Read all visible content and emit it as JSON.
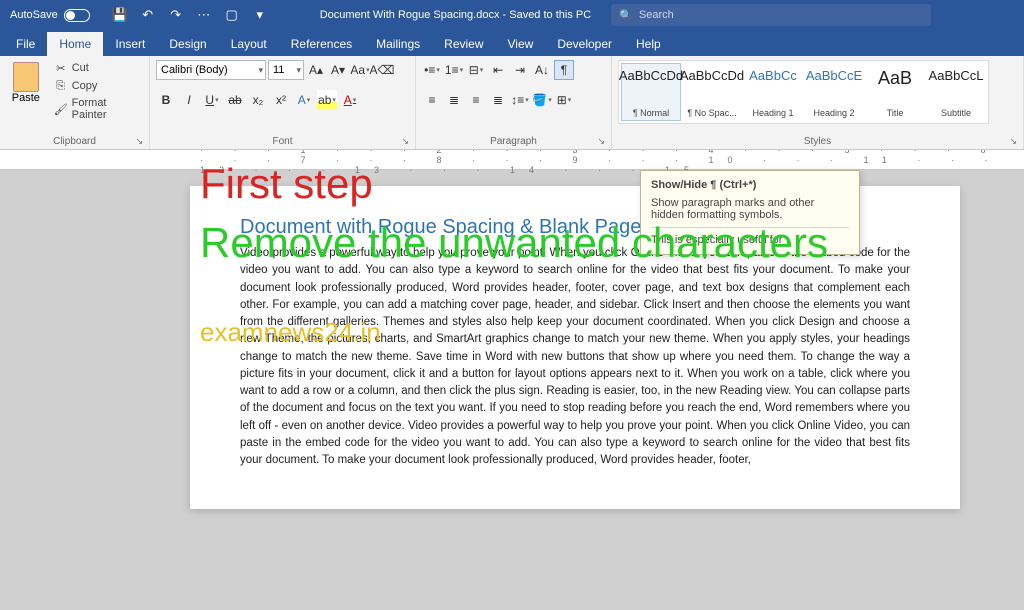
{
  "titlebar": {
    "autosave_label": "AutoSave",
    "autosave_state": "Off",
    "doc_title": "Document With Rogue Spacing.docx - Saved to this PC",
    "search_placeholder": "Search"
  },
  "tabs": [
    "File",
    "Home",
    "Insert",
    "Design",
    "Layout",
    "References",
    "Mailings",
    "Review",
    "View",
    "Developer",
    "Help"
  ],
  "active_tab": "Home",
  "clipboard": {
    "paste": "Paste",
    "cut": "Cut",
    "copy": "Copy",
    "format_painter": "Format Painter",
    "group": "Clipboard"
  },
  "font": {
    "family": "Calibri (Body)",
    "size": "11",
    "group": "Font"
  },
  "paragraph": {
    "group": "Paragraph"
  },
  "styles": {
    "group": "Styles",
    "items": [
      {
        "sample": "AaBbCcDd",
        "name": "¶ Normal",
        "cls": ""
      },
      {
        "sample": "AaBbCcDd",
        "name": "¶ No Spac...",
        "cls": ""
      },
      {
        "sample": "AaBbCc",
        "name": "Heading 1",
        "cls": "h1"
      },
      {
        "sample": "AaBbCcE",
        "name": "Heading 2",
        "cls": "h2"
      },
      {
        "sample": "AaB",
        "name": "Title",
        "cls": "title"
      },
      {
        "sample": "AaBbCcL",
        "name": "Subtitle",
        "cls": ""
      }
    ]
  },
  "tooltip": {
    "title": "Show/Hide ¶ (Ctrl+*)",
    "body1": "Show paragraph marks and other hidden formatting symbols.",
    "body2": "This is especially useful for"
  },
  "ruler": "· · · 1 · · · 2 · · · 3 · · · 4 · · · 5 · · · 6 · · · 7 · · · 8 · · · 9 · · · 10 · · · 11 · · · 12 · · · 13 · · · 14 · · · 15",
  "document": {
    "heading": "Document with Rogue Spacing & Blank Pages",
    "body": "Video provides a powerful way to help you prove your point. When you click Online Video, you can paste in the embed code for the video you want to add. You can also type a keyword to search online for the video that best fits your document. To make your document look professionally produced, Word provides header, footer, cover page, and text box designs that complement each other. For example, you can add a matching cover page, header, and sidebar. Click Insert and then choose the elements you want from the different galleries. Themes and styles also help keep your document coordinated. When you click Design and choose a new Theme, the pictures, charts, and SmartArt graphics change to match your new theme. When you apply styles, your headings change to match the new theme. Save time in Word with new buttons that show up where you need them. To change the way a picture fits in your document, click it and a button for layout options appears next to it. When you work on a table, click where you want to add a row or a column, and then click the plus sign. Reading is easier, too, in the new Reading view. You can collapse parts of the document and focus on the text you want. If you need to stop reading before you reach the end, Word remembers where you left off - even on another device. Video provides a powerful way to help you prove your point. When you click Online Video, you can paste in the embed code for the video you want to add. You can also type a keyword to search online for the video that best fits your document. To make your document look professionally produced, Word provides header, footer,"
  },
  "overlay": {
    "line1": "First step",
    "line2": "Remove the unwanted characters",
    "watermark": "examnews24.in"
  }
}
